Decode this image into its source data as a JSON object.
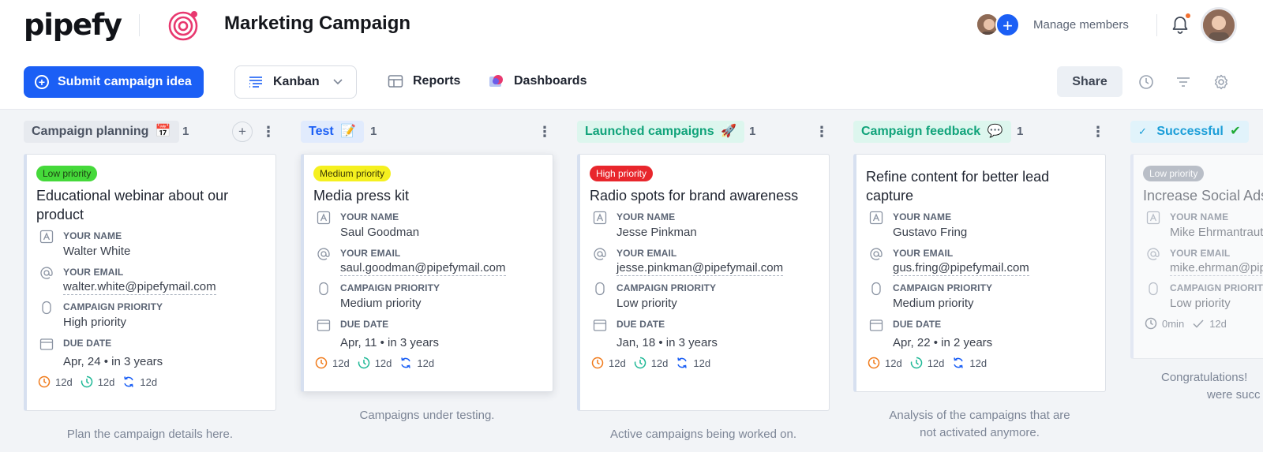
{
  "header": {
    "logo_text": "pipefy",
    "pipe_title": "Marketing Campaign",
    "manage_members": "Manage members",
    "add_member_icon": "+"
  },
  "toolbar": {
    "submit_label": "Submit campaign idea",
    "view_label": "Kanban",
    "reports_label": "Reports",
    "dashboards_label": "Dashboards",
    "share_label": "Share"
  },
  "colors": {
    "brand_blue": "#1b5ff5",
    "low_priority": "#45d93a",
    "medium_priority": "#f5f01f",
    "high_priority": "#e8262c"
  },
  "phases": [
    {
      "name": "Campaign planning",
      "emoji": "📅",
      "count": "1",
      "description": "Plan the campaign details here.",
      "card": {
        "priority": "Low priority",
        "title": "Educational webinar about our product",
        "fields": [
          {
            "label": "YOUR NAME",
            "value": "Walter White"
          },
          {
            "label": "YOUR EMAIL",
            "value": "walter.white@pipefymail.com"
          },
          {
            "label": "CAMPAIGN PRIORITY",
            "value": "High priority"
          },
          {
            "label": "DUE DATE",
            "value": "Apr, 24 • in 3 years"
          }
        ],
        "timers": [
          "12d",
          "12d",
          "12d"
        ]
      }
    },
    {
      "name": "Test",
      "emoji": "📝",
      "count": "1",
      "description": "Campaigns under testing.",
      "card": {
        "priority": "Medium priority",
        "title": "Media press kit",
        "fields": [
          {
            "label": "YOUR NAME",
            "value": "Saul Goodman"
          },
          {
            "label": "YOUR EMAIL",
            "value": "saul.goodman@pipefymail.com"
          },
          {
            "label": "CAMPAIGN PRIORITY",
            "value": "Medium priority"
          },
          {
            "label": "DUE DATE",
            "value": "Apr, 11 • in 3 years"
          }
        ],
        "timers": [
          "12d",
          "12d",
          "12d"
        ]
      }
    },
    {
      "name": "Launched campaigns",
      "emoji": "🚀",
      "count": "1",
      "description": "Active campaigns being worked on.",
      "card": {
        "priority": "High priority",
        "title": "Radio spots for brand awareness",
        "fields": [
          {
            "label": "YOUR NAME",
            "value": "Jesse Pinkman"
          },
          {
            "label": "YOUR EMAIL",
            "value": "jesse.pinkman@pipefymail.com"
          },
          {
            "label": "CAMPAIGN PRIORITY",
            "value": "Low priority"
          },
          {
            "label": "DUE DATE",
            "value": "Jan, 18 • in 3 years"
          }
        ],
        "timers": [
          "12d",
          "12d",
          "12d"
        ]
      }
    },
    {
      "name": "Campaign feedback",
      "emoji": "💬",
      "count": "1",
      "description_line1": "Analysis of the campaigns that are",
      "description_line2": "not activated anymore.",
      "card": {
        "title": "Refine content for better lead capture",
        "fields": [
          {
            "label": "YOUR NAME",
            "value": "Gustavo Fring"
          },
          {
            "label": "YOUR EMAIL",
            "value": "gus.fring@pipefymail.com"
          },
          {
            "label": "CAMPAIGN PRIORITY",
            "value": "Medium priority"
          },
          {
            "label": "DUE DATE",
            "value": "Apr, 22 • in 2 years"
          }
        ],
        "timers": [
          "12d",
          "12d",
          "12d"
        ]
      }
    },
    {
      "name": "Successful",
      "emoji": "✔",
      "check": "✓",
      "description_line1": "Congratulations!",
      "description_line2": "were succ",
      "card": {
        "priority": "Low priority",
        "title": "Increase Social Ads",
        "fields": [
          {
            "label": "YOUR NAME",
            "value": "Mike Ehrmantraut"
          },
          {
            "label": "YOUR EMAIL",
            "value": "mike.ehrman@pip"
          },
          {
            "label": "CAMPAIGN PRIORITY",
            "value": "Low priority"
          }
        ],
        "timers": [
          "0min",
          "12d"
        ]
      }
    }
  ]
}
